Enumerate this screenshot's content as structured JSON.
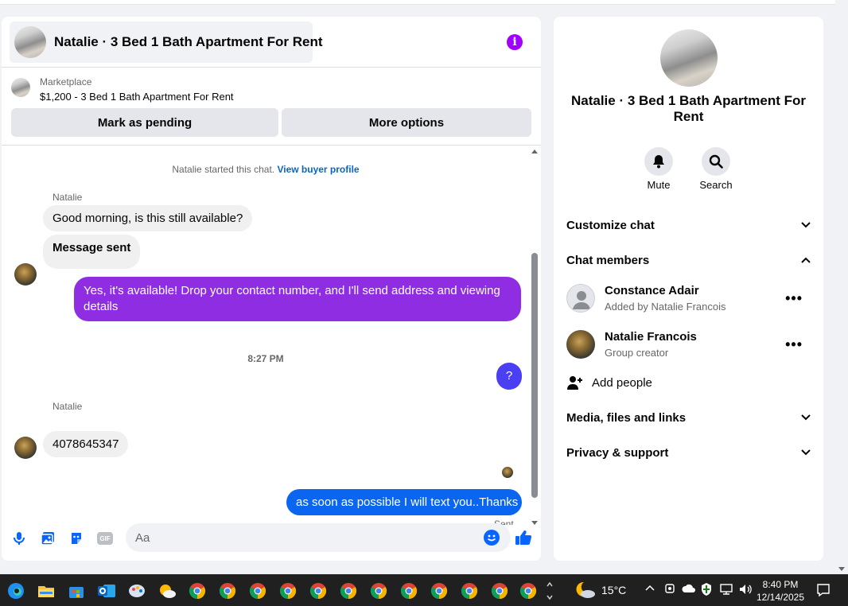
{
  "header": {
    "title": "Natalie · 3 Bed 1 Bath Apartment For Rent",
    "info_icon": "info-icon",
    "info_glyph": "i",
    "accent": "#a100ff"
  },
  "marketplace": {
    "label": "Marketplace",
    "listing": "$1,200 - 3 Bed 1 Bath Apartment For Rent",
    "pending_label": "Mark as pending",
    "more_label": "More options"
  },
  "thread": {
    "system_text": "Natalie started this chat.",
    "system_link": "View buyer profile",
    "messages": [
      {
        "sender": "Natalie",
        "text": "Good morning, is this still available?"
      },
      {
        "text": "Message sent"
      },
      {
        "text": "Yes, it's available! Drop your contact number, and I'll send address and viewing details",
        "color": "#8e2de2"
      },
      {
        "time": "8:27 PM"
      },
      {
        "text": "?",
        "color": "#4a3ff3"
      },
      {
        "sender": "Natalie",
        "text": "4078645347"
      },
      {
        "text": "as soon as possible I will text you..Thanks",
        "color": "#0a66f0"
      },
      {
        "status": "Sent"
      }
    ]
  },
  "composer": {
    "placeholder": "Aa",
    "icons": [
      "microphone-icon",
      "photo-icon",
      "sticker-icon",
      "gif-icon",
      "emoji-icon",
      "thumbs-up-icon"
    ],
    "gif_glyph": "GIF"
  },
  "sidebar": {
    "title": "Natalie · 3 Bed 1 Bath Apartment For Rent",
    "actions": [
      {
        "label": "Mute",
        "icon": "bell-icon"
      },
      {
        "label": "Search",
        "icon": "search-icon"
      }
    ],
    "sections": {
      "customize": "Customize chat",
      "members": "Chat members",
      "media": "Media, files and links",
      "privacy": "Privacy & support"
    },
    "members": [
      {
        "name": "Constance Adair",
        "sub": "Added by Natalie Francois"
      },
      {
        "name": "Natalie Francois",
        "sub": "Group creator"
      }
    ],
    "add_people": "Add people",
    "more_glyph": "•••"
  },
  "taskbar": {
    "weather": "15°C",
    "time": "8:40 PM",
    "date": "12/14/2025",
    "icons": [
      "windows-start-icon",
      "edge-icon",
      "file-explorer-icon",
      "store-icon",
      "outlook-icon",
      "paint-icon",
      "weather-app-icon",
      "chrome-icon"
    ]
  }
}
